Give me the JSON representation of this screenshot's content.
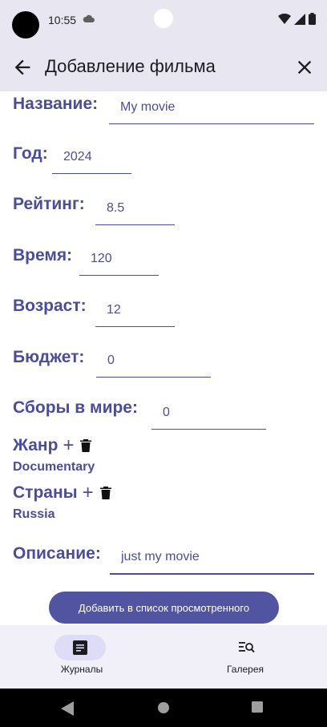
{
  "status_bar": {
    "time": "10:55"
  },
  "app_bar": {
    "title": "Добавление фильма"
  },
  "form": {
    "name_label": "Название:",
    "name_value": "My movie",
    "year_label": "Год:",
    "year_value": "2024",
    "rating_label": "Рейтинг:",
    "rating_value": "8.5",
    "duration_label": "Время:",
    "duration_value": "120",
    "age_label": "Возраст:",
    "age_value": "12",
    "budget_label": "Бюджет:",
    "budget_value": "0",
    "gross_label": "Сборы в мире:",
    "gross_value": "0",
    "genre_label": "Жанр",
    "genre_value": "Documentary",
    "countries_label": "Страны",
    "countries_value": "Russia",
    "description_label": "Описание:",
    "description_value": "just my movie",
    "submit_label": "Добавить в список просмотренного"
  },
  "bottom_nav": {
    "items": [
      {
        "label": "Журналы",
        "icon": "journal-icon",
        "selected": true
      },
      {
        "label": "Галерея",
        "icon": "gallery-search-icon",
        "selected": false
      }
    ]
  },
  "colors": {
    "accent": "#4a4e98",
    "button": "#5054a1",
    "app_bar": "#e8e6f1",
    "nav_pill": "#dedcf6"
  }
}
